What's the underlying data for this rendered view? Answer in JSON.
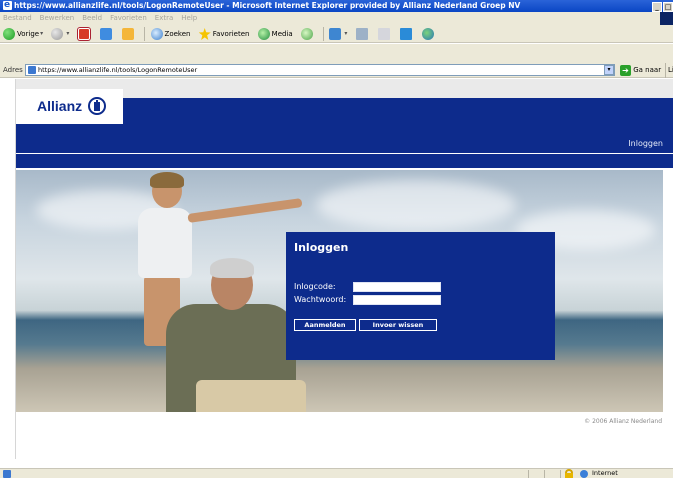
{
  "browser": {
    "window_title": "https://www.allianzlife.nl/tools/LogonRemoteUser - Microsoft Internet Explorer provided by Allianz Nederland Groep NV",
    "window_buttons": {
      "minimize": "_",
      "restore": "□"
    },
    "menu": [
      "Bestand",
      "Bewerken",
      "Beeld",
      "Favorieten",
      "Extra",
      "Help"
    ],
    "toolbar": {
      "back": "Vorige",
      "search": "Zoeken",
      "favorites": "Favorieten",
      "media": "Media"
    },
    "address": {
      "label": "Adres",
      "url": "https://www.allianzlife.nl/tools/LogonRemoteUser",
      "go_label": "Ga naar",
      "links_label": "Li"
    },
    "status": {
      "zone": "Internet"
    }
  },
  "site": {
    "brand": "Allianz",
    "nav_login": "Inloggen",
    "login": {
      "title": "Inloggen",
      "code_label": "Inlogcode:",
      "code_value": "",
      "password_label": "Wachtwoord:",
      "password_value": "",
      "submit_label": "Aanmelden",
      "clear_label": "Invoer wissen"
    },
    "copyright": "© 2006 Allianz Nederland"
  },
  "colors": {
    "brand_blue": "#0d2b8c",
    "titlebar_blue": "#0a46c4",
    "chrome": "#ece9d8"
  },
  "icons": [
    "ie-icon",
    "back-icon",
    "forward-icon",
    "stop-icon",
    "refresh-icon",
    "home-icon",
    "search-icon",
    "favorites-star-icon",
    "media-icon",
    "history-icon",
    "mail-icon",
    "print-icon",
    "edit-icon",
    "discuss-icon",
    "messenger-icon",
    "page-icon",
    "go-arrow-icon",
    "lock-icon",
    "internet-zone-icon",
    "allianz-logo-icon"
  ]
}
